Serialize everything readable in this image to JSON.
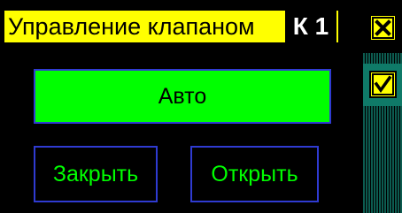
{
  "window": {
    "title": "Управление клапаном",
    "valve_id": "К 1"
  },
  "modes": {
    "auto_label": "Авто",
    "close_label": "Закрыть",
    "open_label": "Открыть"
  },
  "side_panel": {
    "close_icon": "close-x-icon",
    "check_icon": "checkmark-icon"
  },
  "colors": {
    "title_bg": "#ffff00",
    "active_mode": "#00ff00",
    "button_border": "#2f3bd1",
    "panel_bg": "#000000",
    "side_stripes": "#0c5c50"
  }
}
